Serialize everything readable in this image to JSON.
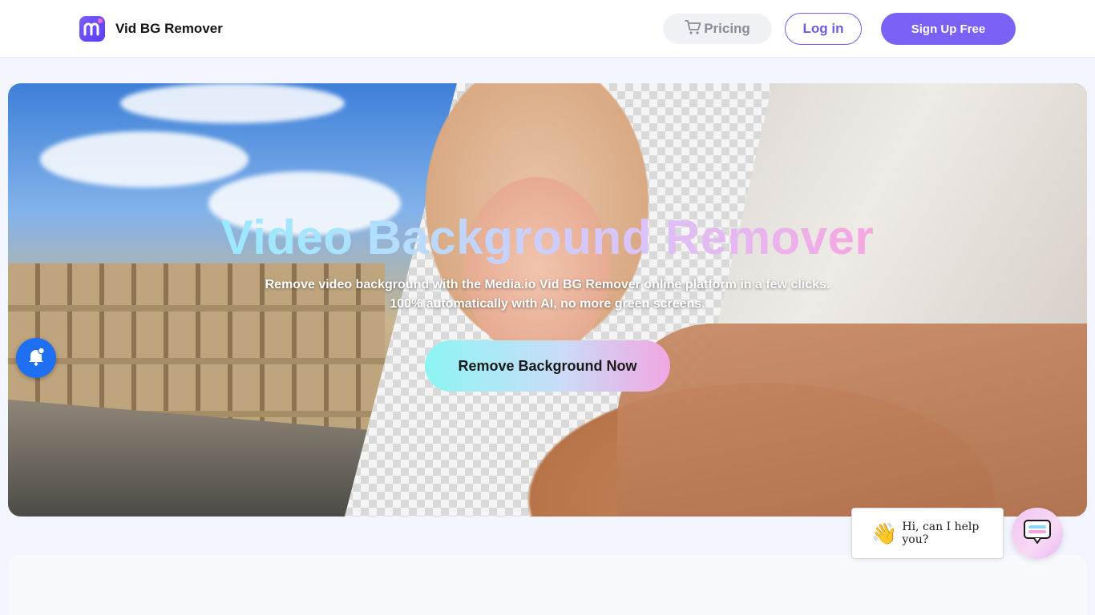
{
  "header": {
    "brand_name": "Vid BG Remover",
    "pricing_label": "Pricing",
    "login_label": "Log in",
    "signup_label": "Sign Up Free"
  },
  "hero": {
    "title": "Video Background Remover",
    "subtitle_line1": "Remove video background with the Media.io Vid BG Remover online platform in a few clicks.",
    "subtitle_line2": "100% automatically with AI, no more green screens.",
    "cta_label": "Remove Background Now"
  },
  "chat": {
    "greeting": "Hi, can I help you?"
  },
  "icons": {
    "brand": "media-io-logo-icon",
    "pricing": "cart-icon",
    "notify": "bell-icon",
    "wave": "waving-hand-icon",
    "chat": "chat-icon"
  },
  "colors": {
    "accent": "#7b61f5",
    "login_border": "#6c5ce7",
    "bell": "#1f6ff2"
  }
}
